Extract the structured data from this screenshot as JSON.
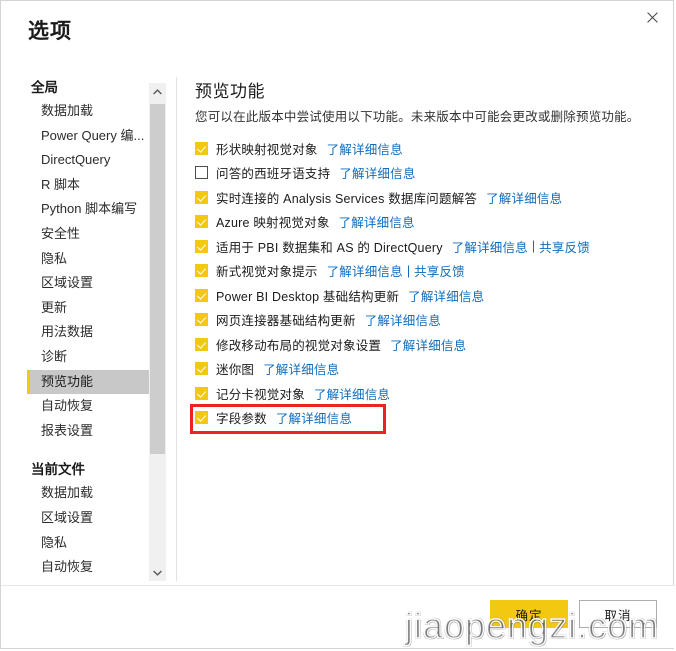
{
  "dialog": {
    "title": "选项",
    "close_icon": "close-icon"
  },
  "sidebar": {
    "groups": [
      {
        "header": "全局",
        "items": [
          {
            "label": "数据加载",
            "selected": false
          },
          {
            "label": "Power Query 编...",
            "selected": false
          },
          {
            "label": "DirectQuery",
            "selected": false
          },
          {
            "label": "R 脚本",
            "selected": false
          },
          {
            "label": "Python 脚本编写",
            "selected": false
          },
          {
            "label": "安全性",
            "selected": false
          },
          {
            "label": "隐私",
            "selected": false
          },
          {
            "label": "区域设置",
            "selected": false
          },
          {
            "label": "更新",
            "selected": false
          },
          {
            "label": "用法数据",
            "selected": false
          },
          {
            "label": "诊断",
            "selected": false
          },
          {
            "label": "预览功能",
            "selected": true
          },
          {
            "label": "自动恢复",
            "selected": false
          },
          {
            "label": "报表设置",
            "selected": false
          }
        ]
      },
      {
        "header": "当前文件",
        "items": [
          {
            "label": "数据加载",
            "selected": false
          },
          {
            "label": "区域设置",
            "selected": false
          },
          {
            "label": "隐私",
            "selected": false
          },
          {
            "label": "自动恢复",
            "selected": false
          }
        ]
      }
    ],
    "scrollbar": {
      "up_icon": "chevron-up-icon",
      "down_icon": "chevron-down-icon"
    }
  },
  "content": {
    "title": "预览功能",
    "description": "您可以在此版本中尝试使用以下功能。未来版本中可能会更改或删除预览功能。",
    "link_label": "了解详细信息",
    "feedback_label": "共享反馈",
    "link_separator": "|",
    "features": [
      {
        "label": "形状映射视觉对象",
        "checked": true,
        "feedback": false
      },
      {
        "label": "问答的西班牙语支持",
        "checked": false,
        "feedback": false
      },
      {
        "label": "实时连接的 Analysis Services 数据库问题解答",
        "checked": true,
        "feedback": false
      },
      {
        "label": "Azure 映射视觉对象",
        "checked": true,
        "feedback": false
      },
      {
        "label": "适用于 PBI 数据集和 AS 的 DirectQuery",
        "checked": true,
        "feedback": true
      },
      {
        "label": "新式视觉对象提示",
        "checked": true,
        "feedback": true
      },
      {
        "label": "Power BI Desktop 基础结构更新",
        "checked": true,
        "feedback": false
      },
      {
        "label": "网页连接器基础结构更新",
        "checked": true,
        "feedback": false
      },
      {
        "label": "修改移动布局的视觉对象设置",
        "checked": true,
        "feedback": false
      },
      {
        "label": "迷你图",
        "checked": true,
        "feedback": false
      },
      {
        "label": "记分卡视觉对象",
        "checked": true,
        "feedback": false
      },
      {
        "label": "字段参数",
        "checked": true,
        "feedback": false
      }
    ]
  },
  "footer": {
    "ok_label": "确定",
    "cancel_label": "取消"
  },
  "annotation": {
    "highlight_color": "#ee2222"
  },
  "watermark": {
    "text": "jiaopengzi.com"
  },
  "colors": {
    "accent": "#f2c811",
    "link": "#0f6cbd",
    "selected_nav_bg": "#c8c8c8"
  }
}
